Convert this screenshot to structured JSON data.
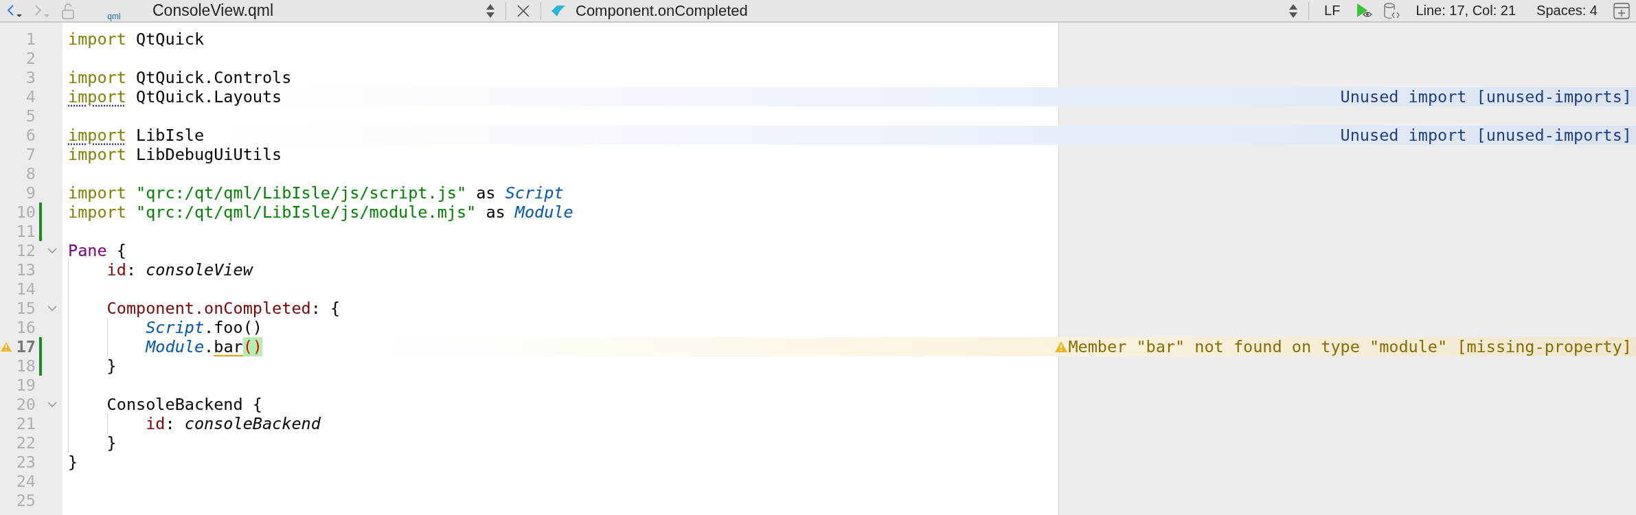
{
  "toolbar": {
    "file_icon_label": "qml",
    "file_name": "ConsoleView.qml",
    "symbol": "Component.onCompleted",
    "line_ending": "LF",
    "cursor": "Line: 17, Col: 21",
    "indent": "Spaces: 4",
    "forward_disabled": true
  },
  "editor": {
    "lines": [
      {
        "number": "1",
        "changed": false,
        "foldable": false,
        "current": false,
        "tokens": [
          {
            "kind": "keyword",
            "text": "import"
          },
          {
            "kind": "plain",
            "text": " QtQuick"
          }
        ]
      },
      {
        "number": "2",
        "changed": false,
        "foldable": false,
        "current": false
      },
      {
        "number": "3",
        "changed": false,
        "foldable": false,
        "current": false,
        "tokens": [
          {
            "kind": "keyword",
            "text": "import"
          },
          {
            "kind": "plain",
            "text": " QtQuick.Controls"
          }
        ]
      },
      {
        "number": "4",
        "changed": false,
        "foldable": false,
        "current": false,
        "tokens": [
          {
            "kind": "keyword",
            "text": "import",
            "underlined": true
          },
          {
            "kind": "plain",
            "text": " QtQuick.Layouts"
          }
        ],
        "annotation": {
          "kind": "info",
          "text": "Unused import [unused-imports]"
        }
      },
      {
        "number": "5",
        "changed": false,
        "foldable": false,
        "current": false
      },
      {
        "number": "6",
        "changed": false,
        "foldable": false,
        "current": false,
        "tokens": [
          {
            "kind": "keyword",
            "text": "import",
            "underlined": true
          },
          {
            "kind": "plain",
            "text": " LibIsle"
          }
        ],
        "annotation": {
          "kind": "info",
          "text": "Unused import [unused-imports]"
        }
      },
      {
        "number": "7",
        "changed": false,
        "foldable": false,
        "current": false,
        "tokens": [
          {
            "kind": "keyword",
            "text": "import"
          },
          {
            "kind": "plain",
            "text": " LibDebugUiUtils"
          }
        ]
      },
      {
        "number": "8",
        "changed": false,
        "foldable": false,
        "current": false
      },
      {
        "number": "9",
        "changed": false,
        "foldable": false,
        "current": false,
        "tokens": [
          {
            "kind": "keyword",
            "text": "import"
          },
          {
            "kind": "string",
            "text": " \"qrc:/qt/qml/LibIsle/js/script.js\""
          },
          {
            "kind": "plain",
            "text": " as "
          },
          {
            "kind": "type",
            "text": "Script"
          }
        ]
      },
      {
        "number": "10",
        "changed": true,
        "foldable": false,
        "current": false,
        "tokens": [
          {
            "kind": "keyword",
            "text": "import"
          },
          {
            "kind": "string",
            "text": " \"qrc:/qt/qml/LibIsle/js/module.mjs\""
          },
          {
            "kind": "plain",
            "text": " as "
          },
          {
            "kind": "type",
            "text": "Module"
          }
        ]
      },
      {
        "number": "11",
        "changed": true,
        "foldable": false,
        "current": false
      },
      {
        "number": "12",
        "changed": false,
        "foldable": true,
        "current": false,
        "tokens": [
          {
            "kind": "element",
            "text": "Pane"
          },
          {
            "kind": "plain",
            "text": " {"
          }
        ]
      },
      {
        "number": "13",
        "changed": false,
        "foldable": false,
        "current": false,
        "tokens": [
          {
            "kind": "property",
            "text": "    id"
          },
          {
            "kind": "plain",
            "text": ": "
          },
          {
            "kind": "idvalue",
            "text": "consoleView"
          }
        ]
      },
      {
        "number": "14",
        "changed": false,
        "foldable": false,
        "current": false
      },
      {
        "number": "15",
        "changed": false,
        "foldable": true,
        "current": false,
        "tokens": [
          {
            "kind": "property",
            "text": "    Component.onCompleted"
          },
          {
            "kind": "plain",
            "text": ": {"
          }
        ]
      },
      {
        "number": "16",
        "changed": false,
        "foldable": false,
        "current": false,
        "tokens": [
          {
            "kind": "type",
            "text": "        Script"
          },
          {
            "kind": "plain",
            "text": ".foo()"
          }
        ]
      },
      {
        "number": "17",
        "changed": true,
        "foldable": false,
        "current": true,
        "tokens": [
          {
            "kind": "type",
            "text": "        Module"
          },
          {
            "kind": "plain",
            "text": "."
          },
          {
            "kind": "plain",
            "text": "bar",
            "underlined": true
          },
          {
            "kind": "match",
            "text": "()"
          }
        ],
        "annotation": {
          "kind": "warning",
          "text": "Member \"bar\" not found on type \"module\" [missing-property]"
        }
      },
      {
        "number": "18",
        "changed": true,
        "foldable": false,
        "current": false,
        "tokens": [
          {
            "kind": "plain",
            "text": "    }"
          }
        ]
      },
      {
        "number": "19",
        "changed": false,
        "foldable": false,
        "current": false
      },
      {
        "number": "20",
        "changed": false,
        "foldable": true,
        "current": false,
        "tokens": [
          {
            "kind": "plain",
            "text": "    ConsoleBackend {"
          }
        ]
      },
      {
        "number": "21",
        "changed": false,
        "foldable": false,
        "current": false,
        "tokens": [
          {
            "kind": "property",
            "text": "        id"
          },
          {
            "kind": "plain",
            "text": ": "
          },
          {
            "kind": "idvalue",
            "text": "consoleBackend"
          }
        ]
      },
      {
        "number": "22",
        "changed": false,
        "foldable": false,
        "current": false,
        "tokens": [
          {
            "kind": "plain",
            "text": "    }"
          }
        ]
      },
      {
        "number": "23",
        "changed": false,
        "foldable": false,
        "current": false,
        "tokens": [
          {
            "kind": "plain",
            "text": "}"
          }
        ]
      },
      {
        "number": "24",
        "changed": false,
        "foldable": false,
        "current": false
      },
      {
        "number": "25",
        "changed": false,
        "foldable": false,
        "current": false
      }
    ]
  }
}
